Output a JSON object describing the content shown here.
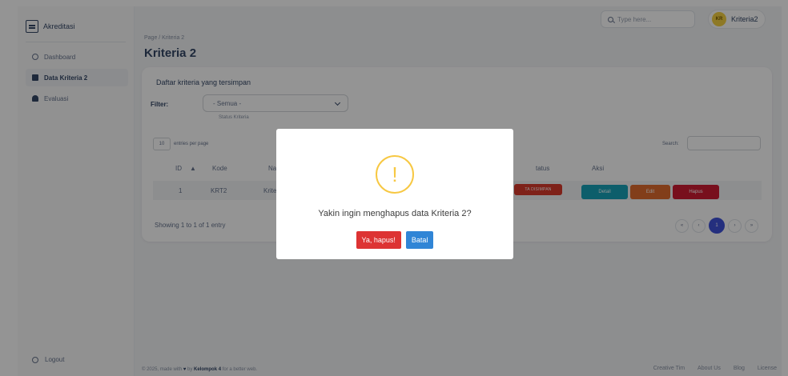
{
  "sidebar": {
    "brand": "Akreditasi",
    "items": [
      {
        "label": "Dashboard",
        "icon": "circle-icon"
      },
      {
        "label": "Data Kriteria 2",
        "icon": "book-icon"
      },
      {
        "label": "Evaluasi",
        "icon": "bell-icon"
      }
    ],
    "logout": "Logout"
  },
  "topbar": {
    "breadcrumb": "Page / Kriteria 2",
    "title": "Kriteria 2",
    "search_placeholder": "Type here...",
    "user_initials": "KR",
    "user_name": "Kriteria2"
  },
  "card": {
    "title": "Daftar kriteria yang tersimpan",
    "filter_label": "Filter:",
    "filter_value": "- Semua -",
    "filter_help": "Status Kriteria",
    "length_value": "10",
    "length_label": "entries per page",
    "search_label": "Search:",
    "columns": [
      "ID",
      "Kode",
      "Na",
      "tatus",
      "Aksi"
    ],
    "row": {
      "id": "1",
      "kode": "KRT2",
      "nama": "Krite",
      "status": "TA DISIMPAN",
      "actions": [
        "Detail",
        "Edit",
        "Hapus"
      ]
    },
    "info": "Showing 1 to 1 of 1 entry",
    "pagination": [
      "«",
      "‹",
      "1",
      "›",
      "»"
    ]
  },
  "footer": {
    "prefix": "© 2025, made with",
    "by": "by",
    "brand": "Kelompok 4",
    "suffix": "for a better web.",
    "links": [
      "Creative Tim",
      "About Us",
      "Blog",
      "License"
    ]
  },
  "modal": {
    "icon_glyph": "!",
    "message": "Yakin ingin menghapus data Kriteria 2?",
    "confirm_label": "Ya, hapus!",
    "cancel_label": "Batal"
  },
  "colors": {
    "accent": "#3f51d9",
    "danger": "#dd3333",
    "cancel": "#3085d6",
    "warning": "#f7c843"
  }
}
